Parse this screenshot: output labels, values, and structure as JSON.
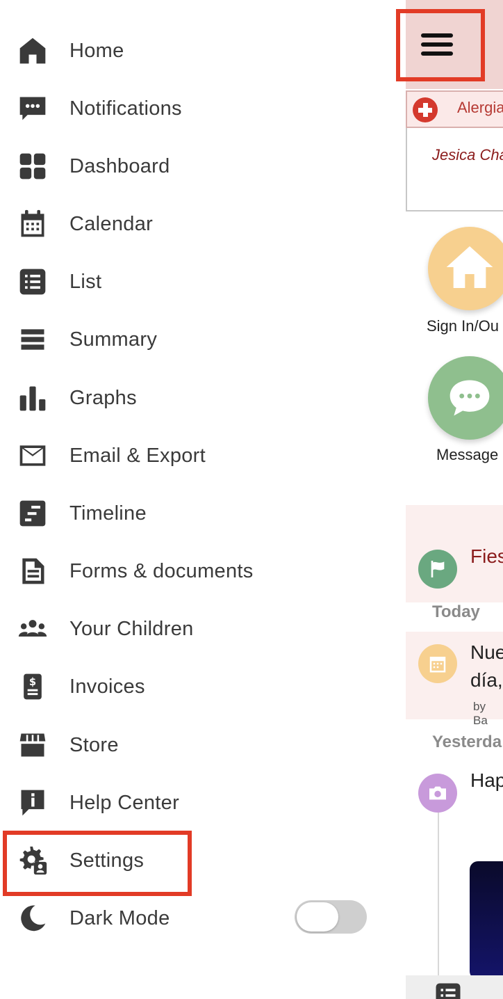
{
  "menu": {
    "items": [
      {
        "label": "Home",
        "icon": "home-icon"
      },
      {
        "label": "Notifications",
        "icon": "chat-bubble-icon"
      },
      {
        "label": "Dashboard",
        "icon": "dashboard-grid-icon"
      },
      {
        "label": "Calendar",
        "icon": "calendar-icon"
      },
      {
        "label": "List",
        "icon": "list-icon"
      },
      {
        "label": "Summary",
        "icon": "summary-lines-icon"
      },
      {
        "label": "Graphs",
        "icon": "bar-graph-icon"
      },
      {
        "label": "Email & Export",
        "icon": "envelope-icon"
      },
      {
        "label": "Timeline",
        "icon": "timeline-icon"
      },
      {
        "label": "Forms & documents",
        "icon": "document-icon"
      },
      {
        "label": "Your Children",
        "icon": "children-group-icon"
      },
      {
        "label": "Invoices",
        "icon": "invoice-dollar-icon"
      },
      {
        "label": "Store",
        "icon": "store-awning-icon"
      },
      {
        "label": "Help Center",
        "icon": "info-bubble-icon"
      },
      {
        "label": "Settings",
        "icon": "settings-gear-user-icon"
      }
    ],
    "dark_mode": {
      "label": "Dark Mode",
      "icon": "moon-icon",
      "enabled": false
    }
  },
  "peek": {
    "allergy_text": "Alergia",
    "child_name": "Jesica Cha",
    "sign_in_label": "Sign In/Ou",
    "messages_label": "Message",
    "event_title": "Fies",
    "today_label": "Today",
    "feed_item_1_line1": "Nue",
    "feed_item_1_line2": "día,",
    "feed_item_1_by": "by Ba",
    "yesterday_label": "Yesterda",
    "feed_item_2": "Hap"
  },
  "colors": {
    "highlight": "#e23b26",
    "header_pink": "#f0d4d2",
    "sign_in_orange": "#f7d08f",
    "messages_green": "#8fbf8e",
    "accent_red": "#8b1c1c"
  }
}
